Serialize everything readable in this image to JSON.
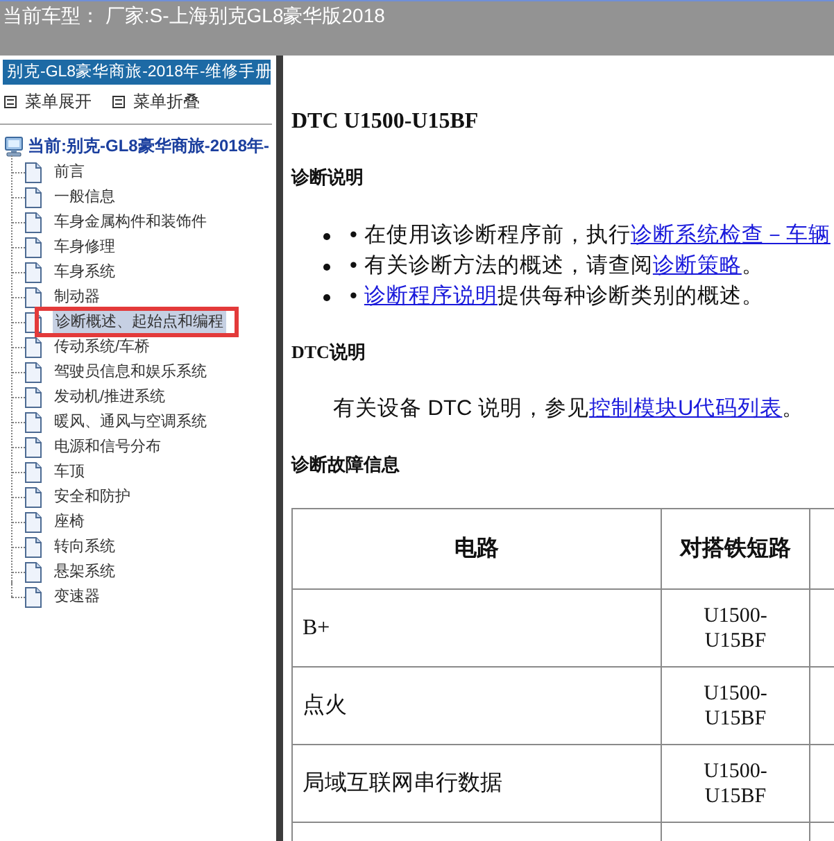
{
  "header": {
    "title": "当前车型： 厂家:S-上海别克GL8豪华版2018"
  },
  "sidebar": {
    "title": "别克-GL8豪华商旅-2018年-维修手册",
    "actions": [
      {
        "label": "菜单展开"
      },
      {
        "label": "菜单折叠"
      }
    ],
    "tree": {
      "label": "当前:别克-GL8豪华商旅-2018年-",
      "children": [
        {
          "label": "前言",
          "selected": false,
          "annotated": false
        },
        {
          "label": "一般信息",
          "selected": false,
          "annotated": false
        },
        {
          "label": "车身金属构件和装饰件",
          "selected": false,
          "annotated": false
        },
        {
          "label": "车身修理",
          "selected": false,
          "annotated": false
        },
        {
          "label": "车身系统",
          "selected": false,
          "annotated": false
        },
        {
          "label": "制动器",
          "selected": false,
          "annotated": false
        },
        {
          "label": "诊断概述、起始点和编程",
          "selected": true,
          "annotated": true
        },
        {
          "label": "传动系统/车桥",
          "selected": false,
          "annotated": false
        },
        {
          "label": "驾驶员信息和娱乐系统",
          "selected": false,
          "annotated": false
        },
        {
          "label": "发动机/推进系统",
          "selected": false,
          "annotated": false
        },
        {
          "label": "暖风、通风与空调系统",
          "selected": false,
          "annotated": false
        },
        {
          "label": "电源和信号分布",
          "selected": false,
          "annotated": false
        },
        {
          "label": "车顶",
          "selected": false,
          "annotated": false
        },
        {
          "label": "安全和防护",
          "selected": false,
          "annotated": false
        },
        {
          "label": "座椅",
          "selected": false,
          "annotated": false
        },
        {
          "label": "转向系统",
          "selected": false,
          "annotated": false
        },
        {
          "label": "悬架系统",
          "selected": false,
          "annotated": false
        },
        {
          "label": "变速器",
          "selected": false,
          "annotated": false
        }
      ]
    }
  },
  "content": {
    "title": "DTC U1500-U15BF",
    "blocks": [
      {
        "kind": "heading",
        "text": "诊断说明"
      },
      {
        "kind": "bullets",
        "items": [
          {
            "marker": "•",
            "parts": [
              {
                "kind": "text",
                "text": "在使用该诊断程序前，执行"
              },
              {
                "kind": "link",
                "text": "诊断系统检查－车辆"
              }
            ]
          },
          {
            "marker": "•",
            "parts": [
              {
                "kind": "text",
                "text": "有关诊断方法的概述，请查阅"
              },
              {
                "kind": "link",
                "text": "诊断策略"
              },
              {
                "kind": "text",
                "text": "。"
              }
            ]
          },
          {
            "marker": "•",
            "parts": [
              {
                "kind": "link",
                "text": "诊断程序说明"
              },
              {
                "kind": "text",
                "text": "提供每种诊断类别的概述。"
              }
            ]
          }
        ]
      },
      {
        "kind": "heading",
        "text": "DTC说明"
      },
      {
        "kind": "paragraph",
        "parts": [
          {
            "kind": "text",
            "text": "有关设备 DTC 说明，参见"
          },
          {
            "kind": "link",
            "text": "控制模块U代码列表"
          },
          {
            "kind": "text",
            "text": "。"
          }
        ]
      },
      {
        "kind": "heading",
        "text": "诊断故障信息"
      },
      {
        "kind": "table",
        "columns": [
          {
            "label": "电路"
          },
          {
            "label": "对搭铁短路"
          }
        ],
        "rows": [
          {
            "cells": [
              "B+",
              "U1500-U15BF"
            ]
          },
          {
            "cells": [
              "点火",
              "U1500-U15BF"
            ]
          },
          {
            "cells": [
              "局域互联网串行数据",
              "U1500-U15BF"
            ]
          }
        ]
      }
    ]
  }
}
